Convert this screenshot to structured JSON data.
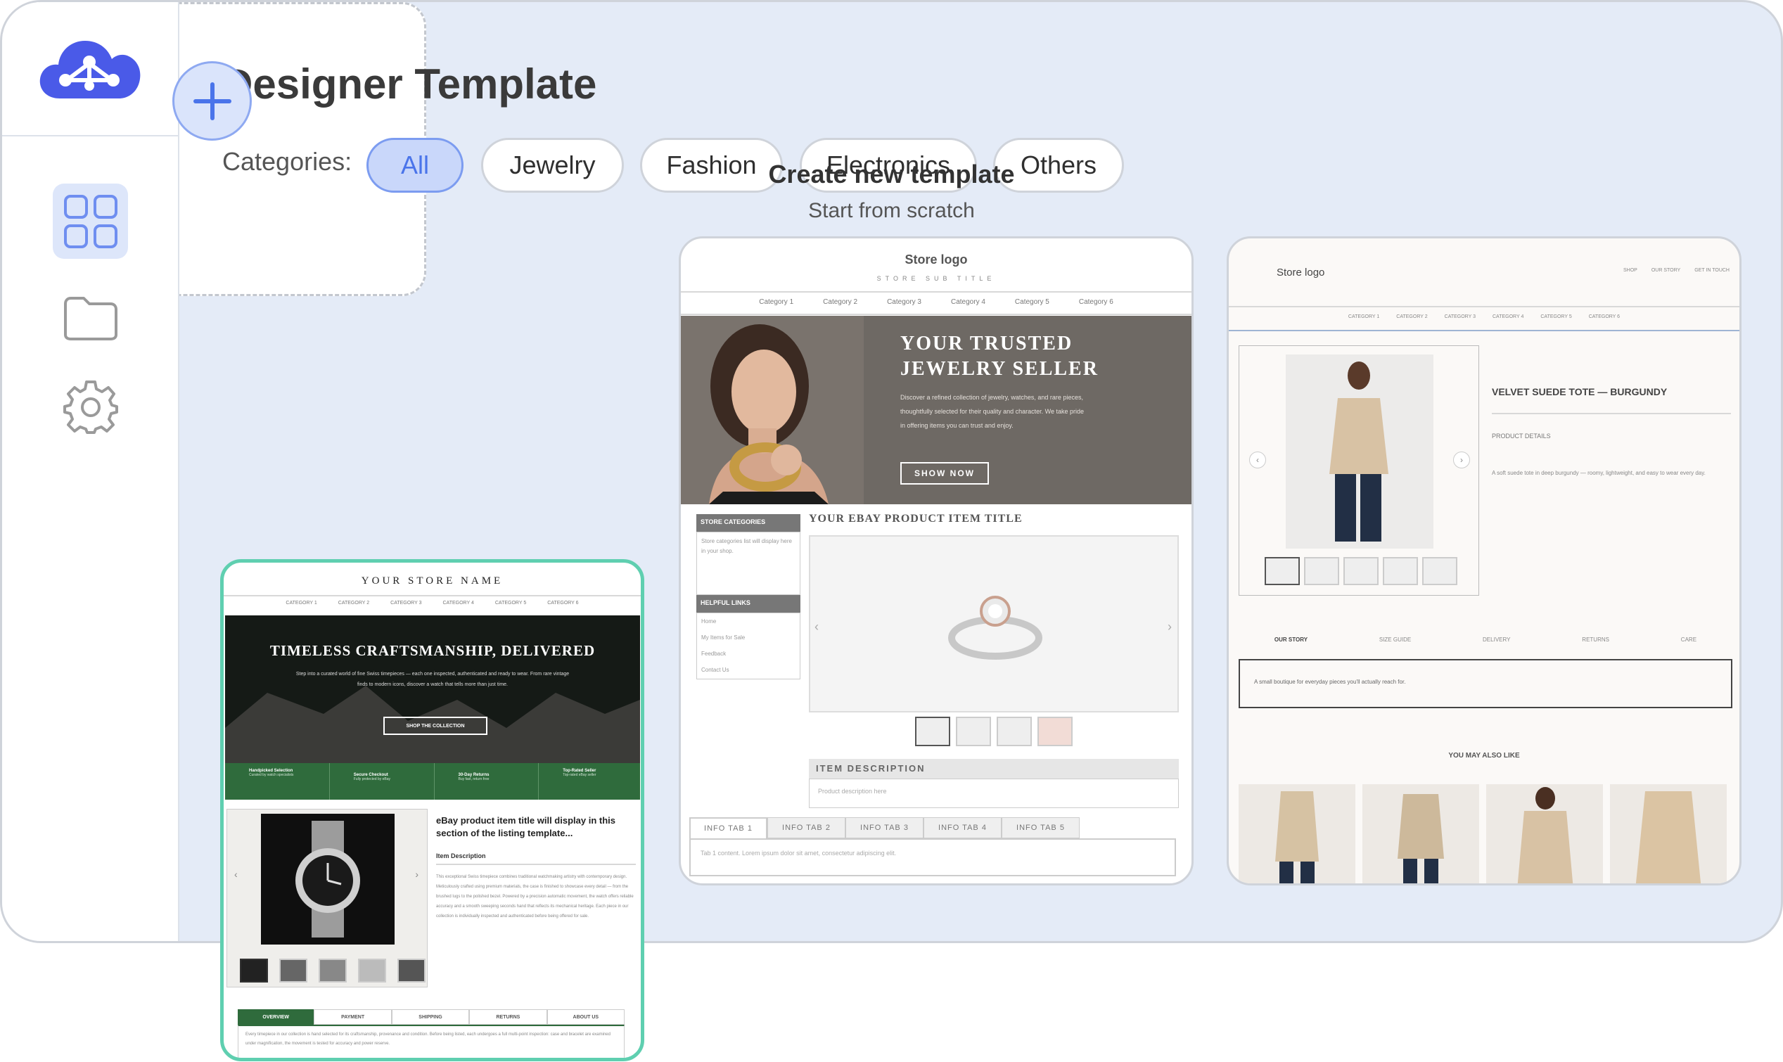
{
  "page": {
    "title": "Designer Template",
    "categories_label": "Categories:"
  },
  "categories": [
    "All",
    "Jewelry",
    "Fashion",
    "Electronics",
    "Others"
  ],
  "colors": {
    "accent": "#4a74ea",
    "frame_bg": "#e4ebf7",
    "selected_outline": "#5fcfb0",
    "logo": "#4a5ae8"
  },
  "sidebar": {
    "items": [
      {
        "icon": "grid-icon",
        "active": true
      },
      {
        "icon": "folder-icon"
      },
      {
        "icon": "gear-icon"
      }
    ]
  },
  "create_card": {
    "title": "Create new template",
    "subtitle": "Start from scratch"
  },
  "jewelry_template": {
    "logo": "Store logo",
    "tagline": "STORE SUB TITLE",
    "nav": [
      "Category 1",
      "Category 2",
      "Category 3",
      "Category 4",
      "Category 5",
      "Category 6"
    ],
    "hero_title_1": "YOUR TRUSTED",
    "hero_title_2": "JEWELRY SELLER",
    "hero_text": "Discover a refined collection of jewelry, watches, and rare pieces, thoughtfully selected for their quality and character. We take pride in offering items you can trust and enjoy.",
    "cta": "SHOW NOW",
    "store_categories": "STORE CATEGORIES",
    "store_categories_text": "Store categories list will display here in your shop.",
    "helpful_links": "HELPFUL LINKS",
    "links": [
      "Home",
      "My Items for Sale",
      "Feedback",
      "Contact Us"
    ],
    "item_title": "YOUR EBAY PRODUCT ITEM TITLE",
    "item_description": "ITEM DESCRIPTION",
    "item_description_text": "Product description here",
    "tabs": [
      "INFO TAB 1",
      "INFO TAB 2",
      "INFO TAB 3",
      "INFO TAB 4",
      "INFO TAB 5"
    ],
    "tab_text": "Tab 1 content. Lorem ipsum dolor sit amet, consectetur adipiscing elit."
  },
  "fashion_template": {
    "logo": "Store logo",
    "links": [
      "SHOP",
      "OUR STORY",
      "GET IN TOUCH"
    ],
    "nav": [
      "CATEGORY 1",
      "CATEGORY 2",
      "CATEGORY 3",
      "CATEGORY 4",
      "CATEGORY 5",
      "CATEGORY 6"
    ],
    "product_title": "VELVET SUEDE TOTE — BURGUNDY",
    "details_label": "PRODUCT DETAILS",
    "details_text": "A soft suede tote in deep burgundy — roomy, lightweight, and easy to wear every day.",
    "tabs": [
      "OUR STORY",
      "SIZE GUIDE",
      "DELIVERY",
      "RETURNS",
      "CARE"
    ],
    "story_text": "A small boutique for everyday pieces you'll actually reach for.",
    "also_like": "YOU MAY ALSO LIKE"
  },
  "watch_template": {
    "store_name": "YOUR STORE NAME",
    "nav": [
      "CATEGORY 1",
      "CATEGORY 2",
      "CATEGORY 3",
      "CATEGORY 4",
      "CATEGORY 5",
      "CATEGORY 6"
    ],
    "hero_title": "TIMELESS CRAFTSMANSHIP, DELIVERED",
    "hero_text": "Step into a curated world of fine Swiss timepieces — each one inspected, authenticated and ready to wear. From rare vintage finds to modern icons, discover a watch that tells more than just time.",
    "cta": "SHOP THE COLLECTION",
    "features": [
      {
        "title": "Handpicked Selection",
        "sub": "Curated by watch specialists"
      },
      {
        "title": "Secure Checkout",
        "sub": "Fully protected by eBay"
      },
      {
        "title": "30-Day Returns",
        "sub": "Buy fast, return free"
      },
      {
        "title": "Top-Rated Seller",
        "sub": "Top-rated eBay seller"
      }
    ],
    "item_title": "eBay product item title will display in this section of the listing template...",
    "desc_label": "Item Description",
    "desc_text": "This exceptional Swiss timepiece combines traditional watchmaking artistry with contemporary design. Meticulously crafted using premium materials, the case is finished to showcase every detail — from the brushed lugs to the polished bezel. Powered by a precision automatic movement, the watch offers reliable accuracy and a smooth sweeping seconds hand that reflects its mechanical heritage. Each piece in our collection is individually inspected and authenticated before being offered for sale.",
    "tabs": [
      "OVERVIEW",
      "PAYMENT",
      "SHIPPING",
      "RETURNS",
      "ABOUT US"
    ],
    "tab_text": "Every timepiece in our collection is hand selected for its craftsmanship, provenance and condition. Before being listed, each undergoes a full multi-point inspection: case and bracelet are examined under magnification, the movement is tested for accuracy and power reserve."
  }
}
